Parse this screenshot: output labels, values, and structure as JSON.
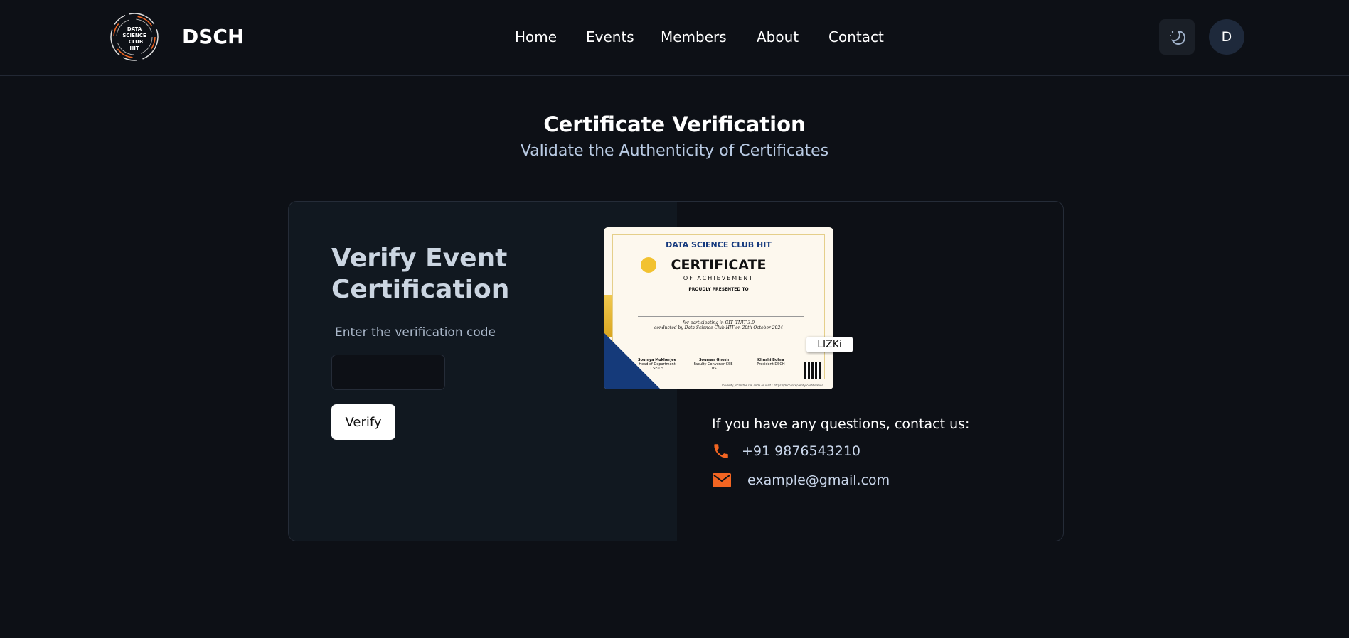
{
  "nav": {
    "brand": "DSCH",
    "logo_text": "DATA SCIENCE CLUB HIT",
    "links": [
      "Home",
      "Events",
      "Members",
      "About",
      "Contact"
    ],
    "avatar_letter": "D",
    "theme_icon": "moon-icon"
  },
  "header": {
    "title": "Certificate Verification",
    "subtitle": "Validate the Authenticity of Certificates"
  },
  "form": {
    "heading": "Verify Event Certification",
    "label": "Enter the verification code",
    "input_value": "",
    "verify_label": "Verify"
  },
  "certificate": {
    "club": "DATA SCIENCE CLUB HIT",
    "title": "CERTIFICATE",
    "subtitle": "OF ACHIEVEMENT",
    "presented": "PROUDLY PRESENTED TO",
    "line1": "for participating in GIT- TNIT 3.0",
    "line2": "conducted by Data Science Club HIT on 20th October 2024",
    "signatories": [
      {
        "name": "Soumya Mukherjee",
        "role": "Head of Department CSE-DS"
      },
      {
        "name": "Souman Ghosh",
        "role": "Faculty Convenor CSE-DS"
      },
      {
        "name": "Khushi Bohra",
        "role": "President DSCH"
      }
    ],
    "footer": "To verify, scan the QR code or visit : https://dsch.site/verify-certification",
    "code": "LIZKi"
  },
  "contact": {
    "prompt": "If you have any questions, contact us:",
    "phone": "+91 9876543210",
    "email": "example@gmail.com",
    "icon_color": "#f26522"
  }
}
